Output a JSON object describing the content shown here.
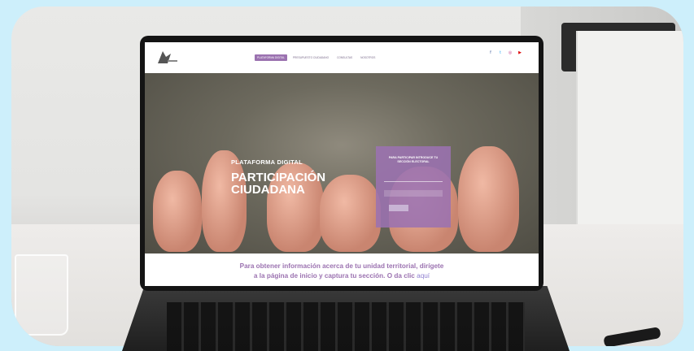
{
  "nav": {
    "tabs": [
      "PLATAFORMA DIGITAL",
      "PRESUPUESTO CIUDADANO",
      "CONSULTAS",
      "NOSOTROS"
    ],
    "active_index": 0,
    "social_icons": [
      "facebook-icon",
      "twitter-icon",
      "instagram-icon",
      "youtube-icon"
    ]
  },
  "hero": {
    "kicker": "PLATAFORMA DIGITAL",
    "title_line1": "PARTICIPACIÓN",
    "title_line2": "CIUDADANA"
  },
  "panel": {
    "title": "PARA PARTICIPAR INTRODUCE TU SECCIÓN ELECTORAL"
  },
  "banner": {
    "line1": "Para obtener información acerca de tu unidad territorial, dirígete",
    "line2": "a la página de inicio y captura tu sección. O da clic",
    "link": "aquí"
  },
  "colors": {
    "accent": "#9b72b0",
    "background": "#cdeffb"
  }
}
